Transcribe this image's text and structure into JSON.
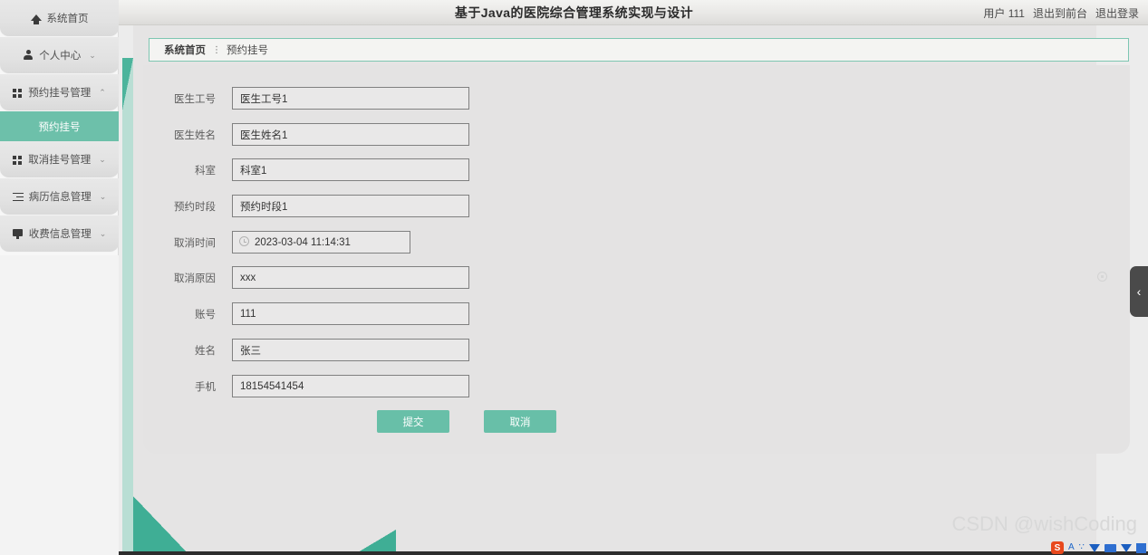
{
  "header": {
    "title": "基于Java的医院综合管理系统实现与设计",
    "user_label": "用户 111",
    "logout_front": "退出到前台",
    "logout": "退出登录"
  },
  "sidebar": {
    "items": [
      {
        "label": "系统首页",
        "icon": "home-icon",
        "caret": "",
        "active": false
      },
      {
        "label": "个人中心",
        "icon": "user-icon",
        "caret": "⌄",
        "active": false
      },
      {
        "label": "预约挂号管理",
        "icon": "grid-icon",
        "caret": "⌃",
        "active": false
      },
      {
        "label": "取消挂号管理",
        "icon": "grid-icon",
        "caret": "⌄",
        "active": false
      },
      {
        "label": "病历信息管理",
        "icon": "list-icon",
        "caret": "⌄",
        "active": false
      },
      {
        "label": "收费信息管理",
        "icon": "monitor-icon",
        "caret": "⌄",
        "active": false
      }
    ],
    "submenu_label": "预约挂号"
  },
  "breadcrumb": {
    "home": "系统首页",
    "separator": "⋮",
    "current": "预约挂号"
  },
  "form": {
    "fields": [
      {
        "label": "医生工号",
        "value": "医生工号1",
        "type": "text"
      },
      {
        "label": "医生姓名",
        "value": "医生姓名1",
        "type": "text"
      },
      {
        "label": "科室",
        "value": "科室1",
        "type": "text"
      },
      {
        "label": "预约时段",
        "value": "预约时段1",
        "type": "text"
      },
      {
        "label": "取消时间",
        "value": "2023-03-04 11:14:31",
        "type": "datetime"
      },
      {
        "label": "取消原因",
        "value": "xxx",
        "type": "text"
      },
      {
        "label": "账号",
        "value": "111",
        "type": "text"
      },
      {
        "label": "姓名",
        "value": "张三",
        "type": "text"
      },
      {
        "label": "手机",
        "value": "18154541454",
        "type": "text"
      }
    ],
    "submit_label": "提交",
    "cancel_label": "取消"
  },
  "collapse_handle": {
    "glyph": "‹"
  },
  "watermark": {
    "text": "CSDN @wishCoding"
  },
  "ime": {
    "logo": "S",
    "letter": "A",
    "dots": "∵"
  },
  "colors": {
    "accent_teal": "#68bfa8",
    "deco_teal_dark": "#3fae95",
    "deco_teal_light": "#c3e0d8",
    "content_bg": "#e5e4e4"
  }
}
